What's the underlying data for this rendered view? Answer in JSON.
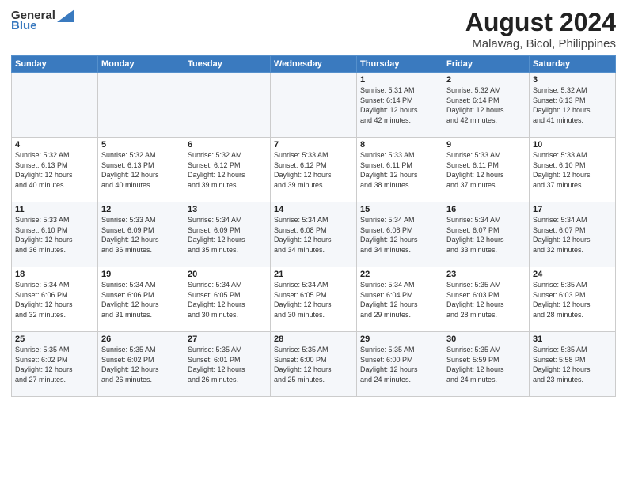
{
  "header": {
    "logo_general": "General",
    "logo_blue": "Blue",
    "main_title": "August 2024",
    "sub_title": "Malawag, Bicol, Philippines"
  },
  "days_of_week": [
    "Sunday",
    "Monday",
    "Tuesday",
    "Wednesday",
    "Thursday",
    "Friday",
    "Saturday"
  ],
  "weeks": [
    [
      {
        "day": "",
        "info": ""
      },
      {
        "day": "",
        "info": ""
      },
      {
        "day": "",
        "info": ""
      },
      {
        "day": "",
        "info": ""
      },
      {
        "day": "1",
        "info": "Sunrise: 5:31 AM\nSunset: 6:14 PM\nDaylight: 12 hours\nand 42 minutes."
      },
      {
        "day": "2",
        "info": "Sunrise: 5:32 AM\nSunset: 6:14 PM\nDaylight: 12 hours\nand 42 minutes."
      },
      {
        "day": "3",
        "info": "Sunrise: 5:32 AM\nSunset: 6:13 PM\nDaylight: 12 hours\nand 41 minutes."
      }
    ],
    [
      {
        "day": "4",
        "info": "Sunrise: 5:32 AM\nSunset: 6:13 PM\nDaylight: 12 hours\nand 40 minutes."
      },
      {
        "day": "5",
        "info": "Sunrise: 5:32 AM\nSunset: 6:13 PM\nDaylight: 12 hours\nand 40 minutes."
      },
      {
        "day": "6",
        "info": "Sunrise: 5:32 AM\nSunset: 6:12 PM\nDaylight: 12 hours\nand 39 minutes."
      },
      {
        "day": "7",
        "info": "Sunrise: 5:33 AM\nSunset: 6:12 PM\nDaylight: 12 hours\nand 39 minutes."
      },
      {
        "day": "8",
        "info": "Sunrise: 5:33 AM\nSunset: 6:11 PM\nDaylight: 12 hours\nand 38 minutes."
      },
      {
        "day": "9",
        "info": "Sunrise: 5:33 AM\nSunset: 6:11 PM\nDaylight: 12 hours\nand 37 minutes."
      },
      {
        "day": "10",
        "info": "Sunrise: 5:33 AM\nSunset: 6:10 PM\nDaylight: 12 hours\nand 37 minutes."
      }
    ],
    [
      {
        "day": "11",
        "info": "Sunrise: 5:33 AM\nSunset: 6:10 PM\nDaylight: 12 hours\nand 36 minutes."
      },
      {
        "day": "12",
        "info": "Sunrise: 5:33 AM\nSunset: 6:09 PM\nDaylight: 12 hours\nand 36 minutes."
      },
      {
        "day": "13",
        "info": "Sunrise: 5:34 AM\nSunset: 6:09 PM\nDaylight: 12 hours\nand 35 minutes."
      },
      {
        "day": "14",
        "info": "Sunrise: 5:34 AM\nSunset: 6:08 PM\nDaylight: 12 hours\nand 34 minutes."
      },
      {
        "day": "15",
        "info": "Sunrise: 5:34 AM\nSunset: 6:08 PM\nDaylight: 12 hours\nand 34 minutes."
      },
      {
        "day": "16",
        "info": "Sunrise: 5:34 AM\nSunset: 6:07 PM\nDaylight: 12 hours\nand 33 minutes."
      },
      {
        "day": "17",
        "info": "Sunrise: 5:34 AM\nSunset: 6:07 PM\nDaylight: 12 hours\nand 32 minutes."
      }
    ],
    [
      {
        "day": "18",
        "info": "Sunrise: 5:34 AM\nSunset: 6:06 PM\nDaylight: 12 hours\nand 32 minutes."
      },
      {
        "day": "19",
        "info": "Sunrise: 5:34 AM\nSunset: 6:06 PM\nDaylight: 12 hours\nand 31 minutes."
      },
      {
        "day": "20",
        "info": "Sunrise: 5:34 AM\nSunset: 6:05 PM\nDaylight: 12 hours\nand 30 minutes."
      },
      {
        "day": "21",
        "info": "Sunrise: 5:34 AM\nSunset: 6:05 PM\nDaylight: 12 hours\nand 30 minutes."
      },
      {
        "day": "22",
        "info": "Sunrise: 5:34 AM\nSunset: 6:04 PM\nDaylight: 12 hours\nand 29 minutes."
      },
      {
        "day": "23",
        "info": "Sunrise: 5:35 AM\nSunset: 6:03 PM\nDaylight: 12 hours\nand 28 minutes."
      },
      {
        "day": "24",
        "info": "Sunrise: 5:35 AM\nSunset: 6:03 PM\nDaylight: 12 hours\nand 28 minutes."
      }
    ],
    [
      {
        "day": "25",
        "info": "Sunrise: 5:35 AM\nSunset: 6:02 PM\nDaylight: 12 hours\nand 27 minutes."
      },
      {
        "day": "26",
        "info": "Sunrise: 5:35 AM\nSunset: 6:02 PM\nDaylight: 12 hours\nand 26 minutes."
      },
      {
        "day": "27",
        "info": "Sunrise: 5:35 AM\nSunset: 6:01 PM\nDaylight: 12 hours\nand 26 minutes."
      },
      {
        "day": "28",
        "info": "Sunrise: 5:35 AM\nSunset: 6:00 PM\nDaylight: 12 hours\nand 25 minutes."
      },
      {
        "day": "29",
        "info": "Sunrise: 5:35 AM\nSunset: 6:00 PM\nDaylight: 12 hours\nand 24 minutes."
      },
      {
        "day": "30",
        "info": "Sunrise: 5:35 AM\nSunset: 5:59 PM\nDaylight: 12 hours\nand 24 minutes."
      },
      {
        "day": "31",
        "info": "Sunrise: 5:35 AM\nSunset: 5:58 PM\nDaylight: 12 hours\nand 23 minutes."
      }
    ]
  ]
}
